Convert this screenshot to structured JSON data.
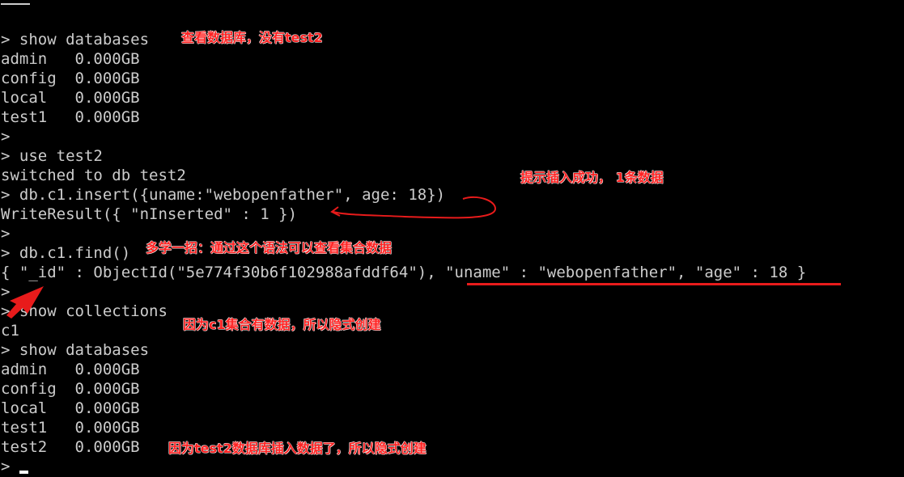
{
  "terminal": {
    "lines": [
      "> show databases",
      "admin   0.000GB",
      "config  0.000GB",
      "local   0.000GB",
      "test1   0.000GB",
      ">",
      "> use test2",
      "switched to db test2",
      "> db.c1.insert({uname:\"webopenfather\", age: 18})",
      "WriteResult({ \"nInserted\" : 1 })",
      ">",
      "> db.c1.find()",
      "{ \"_id\" : ObjectId(\"5e774f30b6f102988afddf64\"), \"uname\" : \"webopenfather\", \"age\" : 18 }",
      ">",
      "> show collections",
      "c1",
      "> show databases",
      "admin   0.000GB",
      "config  0.000GB",
      "local   0.000GB",
      "test1   0.000GB",
      "test2   0.000GB",
      ">"
    ]
  },
  "annotations": {
    "no_test2": "查看数据库，没有test2",
    "insert_success": "提示插入成功， 1条数据",
    "find_tip": "多学一招：通过这个语法可以查看集合数据",
    "implicit_collection": "因为c1集合有数据，所以隐式创建",
    "implicit_database": "因为test2数据库插入数据了，所以隐式创建"
  },
  "colors": {
    "background": "#000000",
    "text": "#cccccc",
    "annotation": "#ff2222"
  }
}
